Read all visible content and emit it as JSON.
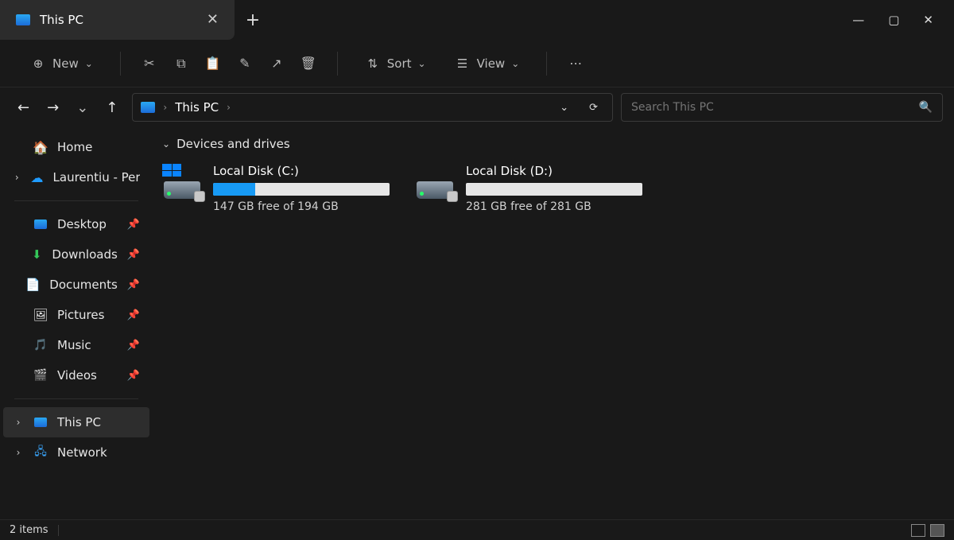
{
  "tab": {
    "title": "This PC"
  },
  "toolbar": {
    "new_label": "New",
    "sort_label": "Sort",
    "view_label": "View"
  },
  "address": {
    "location": "This PC"
  },
  "search": {
    "placeholder": "Search This PC"
  },
  "section": {
    "title": "Devices and drives"
  },
  "drives": [
    {
      "name": "Local Disk (C:)",
      "subtext": "147 GB free of 194 GB",
      "used_pct": 24,
      "has_winflag": true
    },
    {
      "name": "Local Disk (D:)",
      "subtext": "281 GB free of 281 GB",
      "used_pct": 0,
      "has_winflag": false
    }
  ],
  "sidebar": {
    "top": [
      {
        "label": "Home",
        "icon": "home",
        "expandable": false
      },
      {
        "label": "Laurentiu - Persona",
        "icon": "cloud",
        "expandable": true
      }
    ],
    "pinned": [
      {
        "label": "Desktop",
        "icon": "desk"
      },
      {
        "label": "Downloads",
        "icon": "down"
      },
      {
        "label": "Documents",
        "icon": "doc"
      },
      {
        "label": "Pictures",
        "icon": "pic"
      },
      {
        "label": "Music",
        "icon": "mus"
      },
      {
        "label": "Videos",
        "icon": "vid"
      }
    ],
    "bottom": [
      {
        "label": "This PC",
        "icon": "pc",
        "active": true
      },
      {
        "label": "Network",
        "icon": "net",
        "active": false
      }
    ]
  },
  "status": {
    "text": "2 items"
  }
}
